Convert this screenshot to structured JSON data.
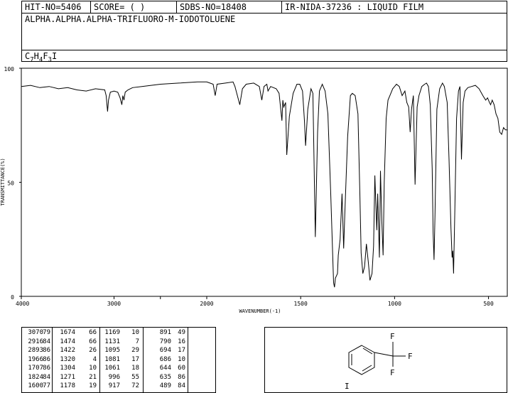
{
  "header": {
    "hit_no": "HIT-NO=5406",
    "score": "SCORE=  (   )",
    "sdbs_no": "SDBS-NO=18408",
    "ir_info": "IR-NIDA-37236 : LIQUID FILM",
    "compound_name": "ALPHA.ALPHA.ALPHA-TRIFLUORO-M-IODOTOLUENE",
    "formula": {
      "c": "C",
      "c_n": "7",
      "h": "H",
      "h_n": "4",
      "f": "F",
      "f_n": "3",
      "i": "I"
    }
  },
  "chart_data": {
    "type": "line",
    "xlabel": "WAVENUMBER(-1)",
    "ylabel": "TRANSMITTANCE(%)",
    "xlim": [
      4000,
      400
    ],
    "ylim": [
      0,
      100
    ],
    "x_ticks": [
      4000,
      3000,
      2500,
      2000,
      1500,
      1000,
      500
    ],
    "x_tick_labels": [
      "4000",
      "3000",
      "2000",
      "1500",
      "1000",
      "500"
    ],
    "y_tick_labels": [
      "100",
      "50",
      "0"
    ],
    "y_ticks": [
      100,
      50,
      0
    ],
    "series": [
      {
        "points": [
          [
            4000,
            92
          ],
          [
            3900,
            92.5
          ],
          [
            3800,
            91.5
          ],
          [
            3700,
            92
          ],
          [
            3600,
            91
          ],
          [
            3500,
            91.5
          ],
          [
            3400,
            90.5
          ],
          [
            3300,
            90
          ],
          [
            3200,
            91
          ],
          [
            3100,
            90.5
          ],
          [
            3085,
            88
          ],
          [
            3070,
            81
          ],
          [
            3060,
            86
          ],
          [
            3040,
            89.5
          ],
          [
            3000,
            90
          ],
          [
            2960,
            89.5
          ],
          [
            2935,
            87
          ],
          [
            2916,
            84
          ],
          [
            2905,
            88
          ],
          [
            2893,
            86
          ],
          [
            2880,
            89.5
          ],
          [
            2850,
            90.5
          ],
          [
            2800,
            91.5
          ],
          [
            2700,
            92
          ],
          [
            2600,
            92.5
          ],
          [
            2500,
            93
          ],
          [
            2300,
            93.5
          ],
          [
            2100,
            94
          ],
          [
            2000,
            94
          ],
          [
            1966,
            93
          ],
          [
            1955,
            88
          ],
          [
            1945,
            93
          ],
          [
            1900,
            93.5
          ],
          [
            1860,
            94
          ],
          [
            1850,
            92
          ],
          [
            1824,
            84
          ],
          [
            1810,
            91
          ],
          [
            1790,
            93
          ],
          [
            1750,
            93.5
          ],
          [
            1720,
            92
          ],
          [
            1707,
            86
          ],
          [
            1695,
            92
          ],
          [
            1680,
            93
          ],
          [
            1674,
            90
          ],
          [
            1660,
            92
          ],
          [
            1630,
            91
          ],
          [
            1615,
            89
          ],
          [
            1600,
            77
          ],
          [
            1595,
            86
          ],
          [
            1590,
            83
          ],
          [
            1580,
            85
          ],
          [
            1574,
            62
          ],
          [
            1560,
            79
          ],
          [
            1540,
            89
          ],
          [
            1520,
            93
          ],
          [
            1505,
            93
          ],
          [
            1490,
            90
          ],
          [
            1480,
            77
          ],
          [
            1474,
            66
          ],
          [
            1462,
            82
          ],
          [
            1445,
            91
          ],
          [
            1435,
            89
          ],
          [
            1422,
            26
          ],
          [
            1410,
            72
          ],
          [
            1400,
            90
          ],
          [
            1385,
            93
          ],
          [
            1370,
            90
          ],
          [
            1355,
            80
          ],
          [
            1340,
            45
          ],
          [
            1325,
            6
          ],
          [
            1320,
            4
          ],
          [
            1315,
            8
          ],
          [
            1304,
            10
          ],
          [
            1300,
            18
          ],
          [
            1290,
            25
          ],
          [
            1280,
            45
          ],
          [
            1271,
            21
          ],
          [
            1265,
            36
          ],
          [
            1250,
            70
          ],
          [
            1235,
            88
          ],
          [
            1225,
            89
          ],
          [
            1210,
            88
          ],
          [
            1195,
            80
          ],
          [
            1185,
            45
          ],
          [
            1178,
            19
          ],
          [
            1169,
            10
          ],
          [
            1160,
            13
          ],
          [
            1150,
            23
          ],
          [
            1140,
            15
          ],
          [
            1131,
            7
          ],
          [
            1120,
            10
          ],
          [
            1112,
            22
          ],
          [
            1105,
            53
          ],
          [
            1095,
            29
          ],
          [
            1090,
            45
          ],
          [
            1081,
            17
          ],
          [
            1075,
            55
          ],
          [
            1068,
            33
          ],
          [
            1061,
            18
          ],
          [
            1055,
            50
          ],
          [
            1045,
            78
          ],
          [
            1035,
            86
          ],
          [
            1020,
            89
          ],
          [
            1010,
            91
          ],
          [
            1000,
            92
          ],
          [
            990,
            93
          ],
          [
            975,
            92
          ],
          [
            960,
            88
          ],
          [
            945,
            90
          ],
          [
            935,
            85
          ],
          [
            925,
            83
          ],
          [
            917,
            72
          ],
          [
            910,
            82
          ],
          [
            900,
            88
          ],
          [
            891,
            49
          ],
          [
            880,
            83
          ],
          [
            870,
            88
          ],
          [
            855,
            92
          ],
          [
            840,
            93
          ],
          [
            830,
            93.5
          ],
          [
            820,
            92
          ],
          [
            810,
            84
          ],
          [
            800,
            56
          ],
          [
            795,
            28
          ],
          [
            790,
            16
          ],
          [
            785,
            35
          ],
          [
            775,
            82
          ],
          [
            760,
            91
          ],
          [
            745,
            93.5
          ],
          [
            735,
            92
          ],
          [
            720,
            85
          ],
          [
            710,
            60
          ],
          [
            700,
            30
          ],
          [
            694,
            17
          ],
          [
            690,
            20
          ],
          [
            686,
            10
          ],
          [
            680,
            35
          ],
          [
            670,
            78
          ],
          [
            660,
            90
          ],
          [
            652,
            92
          ],
          [
            644,
            60
          ],
          [
            635,
            85
          ],
          [
            625,
            90
          ],
          [
            610,
            91.5
          ],
          [
            590,
            92
          ],
          [
            570,
            92.5
          ],
          [
            550,
            91
          ],
          [
            530,
            88
          ],
          [
            515,
            86
          ],
          [
            505,
            87
          ],
          [
            495,
            85
          ],
          [
            489,
            84
          ],
          [
            480,
            86
          ],
          [
            470,
            84
          ],
          [
            460,
            80
          ],
          [
            450,
            78
          ],
          [
            440,
            72
          ],
          [
            430,
            71
          ],
          [
            420,
            74
          ],
          [
            410,
            73
          ],
          [
            400,
            73
          ]
        ]
      }
    ]
  },
  "peak_table": {
    "rows": [
      [
        "3070",
        "79",
        "1674",
        "66",
        "1169",
        "10",
        "891",
        "49"
      ],
      [
        "2916",
        "84",
        "1474",
        "66",
        "1131",
        "7",
        "790",
        "16"
      ],
      [
        "2893",
        "86",
        "1422",
        "26",
        "1095",
        "29",
        "694",
        "17"
      ],
      [
        "1966",
        "86",
        "1320",
        "4",
        "1081",
        "17",
        "686",
        "10"
      ],
      [
        "1707",
        "86",
        "1304",
        "10",
        "1061",
        "18",
        "644",
        "60"
      ],
      [
        "1824",
        "84",
        "1271",
        "21",
        "996",
        "55",
        "635",
        "86"
      ],
      [
        "1600",
        "77",
        "1178",
        "19",
        "917",
        "72",
        "489",
        "84"
      ]
    ]
  },
  "structure": {
    "atoms": {
      "f_top": "F",
      "f_right": "F",
      "f_bottom": "F",
      "i": "I"
    }
  }
}
